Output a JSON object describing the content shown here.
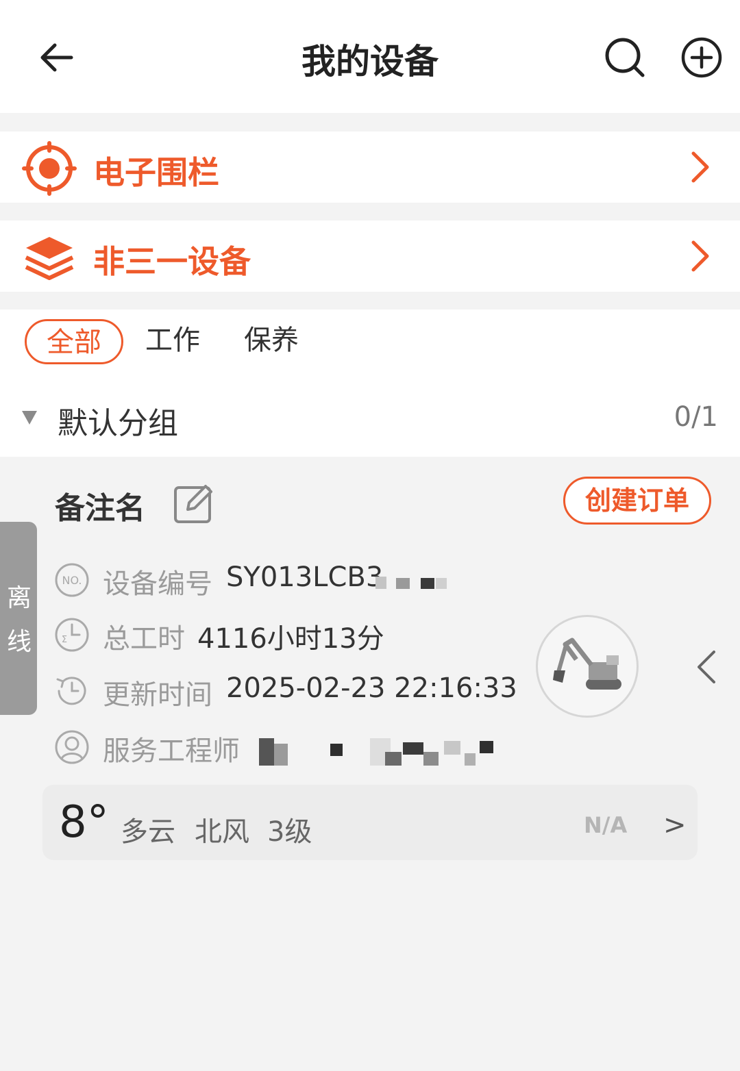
{
  "header": {
    "title": "我的设备",
    "back_icon": "back-arrow-icon",
    "search_icon": "search-icon",
    "add_icon": "add-circle-icon"
  },
  "menu": [
    {
      "label": "电子围栏",
      "icon": "geofence-target-icon"
    },
    {
      "label": "非三一设备",
      "icon": "layers-icon"
    }
  ],
  "filters": {
    "chips": [
      "全部",
      "工作",
      "保养"
    ],
    "active_index": 0
  },
  "group": {
    "label": "默认分组",
    "count": "0/1"
  },
  "device": {
    "remark_name": "备注名",
    "create_order_label": "创建订单",
    "status": "离线",
    "fields": [
      {
        "key": "设备编号",
        "value": "SY013LCB3",
        "icon": "no-badge-icon"
      },
      {
        "key": "总工时",
        "value": "4116小时13分",
        "icon": "hours-clock-icon"
      },
      {
        "key": "更新时间",
        "value": "2025-02-23 22:16:33",
        "icon": "history-icon"
      },
      {
        "key": "服务工程师",
        "value": "",
        "icon": "user-circle-icon"
      }
    ],
    "image_icon": "excavator-icon"
  },
  "weather": {
    "temperature": "8°",
    "condition": "多云",
    "wind_direction": "北风",
    "wind_level": "3级",
    "aqi": "N/A",
    "more": ">"
  },
  "colors": {
    "accent": "#ee5a2b",
    "status_offline": "#9b9b9b",
    "background": "#f3f3f3"
  }
}
